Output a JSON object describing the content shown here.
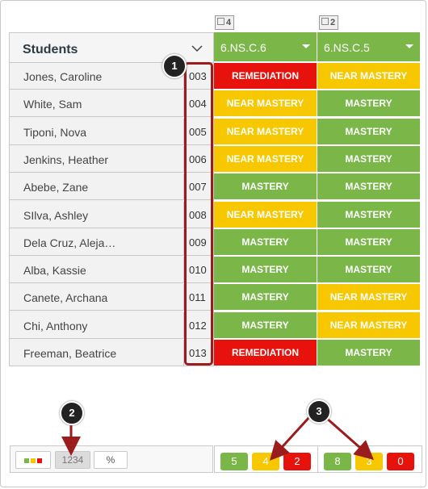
{
  "columns": [
    {
      "count": "4",
      "standard": "6.NS.C.6"
    },
    {
      "count": "2",
      "standard": "6.NS.C.5"
    }
  ],
  "students_label": "Students",
  "students": [
    {
      "name": "Jones, Caroline",
      "id": "003",
      "scores": [
        "REMEDIATION",
        "NEAR MASTERY"
      ]
    },
    {
      "name": "White, Sam",
      "id": "004",
      "scores": [
        "NEAR MASTERY",
        "MASTERY"
      ]
    },
    {
      "name": "Tiponi, Nova",
      "id": "005",
      "scores": [
        "NEAR MASTERY",
        "MASTERY"
      ]
    },
    {
      "name": "Jenkins, Heather",
      "id": "006",
      "scores": [
        "NEAR MASTERY",
        "MASTERY"
      ]
    },
    {
      "name": "Abebe, Zane",
      "id": "007",
      "scores": [
        "MASTERY",
        "MASTERY"
      ]
    },
    {
      "name": "SIlva, Ashley",
      "id": "008",
      "scores": [
        "NEAR MASTERY",
        "MASTERY"
      ]
    },
    {
      "name": "Dela Cruz, Aleja…",
      "id": "009",
      "scores": [
        "MASTERY",
        "MASTERY"
      ]
    },
    {
      "name": "Alba, Kassie",
      "id": "010",
      "scores": [
        "MASTERY",
        "MASTERY"
      ]
    },
    {
      "name": "Canete, Archana",
      "id": "011",
      "scores": [
        "MASTERY",
        "NEAR MASTERY"
      ]
    },
    {
      "name": "Chi, Anthony",
      "id": "012",
      "scores": [
        "MASTERY",
        "NEAR MASTERY"
      ]
    },
    {
      "name": "Freeman, Beatrice",
      "id": "013",
      "scores": [
        "REMEDIATION",
        "MASTERY"
      ]
    }
  ],
  "display_options": {
    "number_label": "1234",
    "percent_label": "%"
  },
  "totals": [
    {
      "mastery": "5",
      "near": "4",
      "remediation": "2"
    },
    {
      "mastery": "8",
      "near": "3",
      "remediation": "0"
    }
  ],
  "callouts": [
    "1",
    "2",
    "3"
  ],
  "colors": {
    "mastery": "#7ab648",
    "near_mastery": "#f7c700",
    "remediation": "#e8120c",
    "callout_arrow": "#9b1c1c"
  }
}
